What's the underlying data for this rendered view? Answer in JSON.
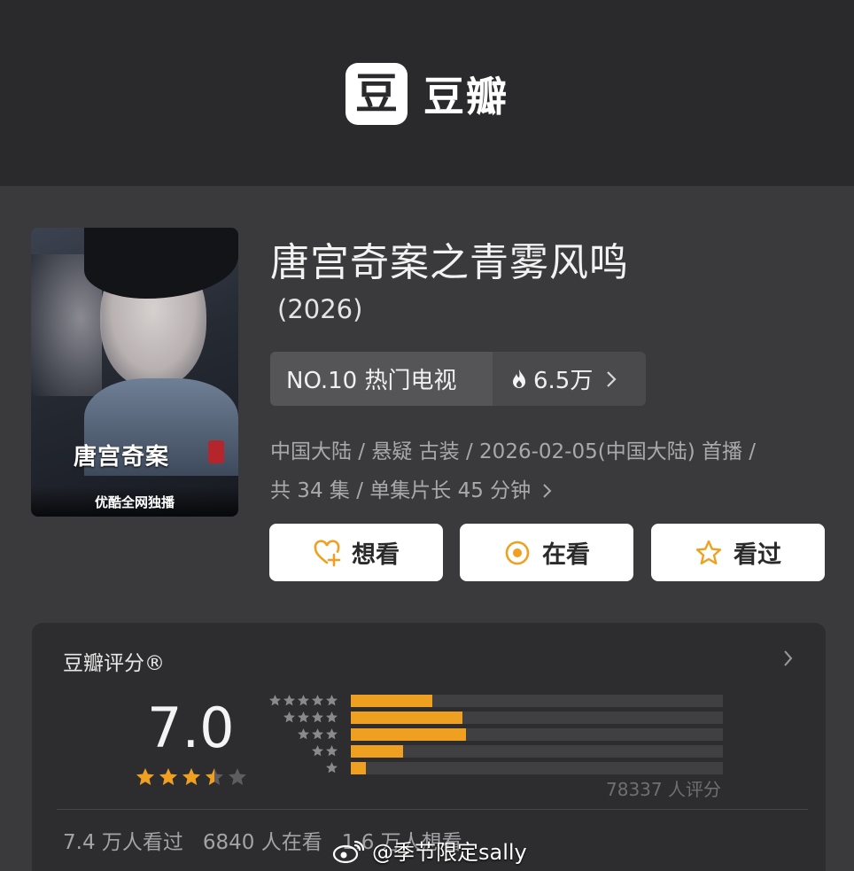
{
  "brand": {
    "logo_glyph": "豆",
    "name": "豆瓣"
  },
  "show": {
    "title": "唐宫奇案之青雾风鸣",
    "year": "(2026)",
    "rank_label": "NO.10 热门电视",
    "heat": "6.5万",
    "meta_line1": "中国大陆 / 悬疑 古装 / 2026-02-05(中国大陆) 首播 /",
    "meta_line2": "共 34 集 / 单集片长 45 分钟",
    "poster": {
      "title_art": "唐宫奇案",
      "channel": "优酷全网独播"
    }
  },
  "actions": {
    "want": "想看",
    "watching": "在看",
    "watched": "看过"
  },
  "rating": {
    "label": "豆瓣评分®",
    "score": "7.0",
    "stars_filled": 3.5,
    "stars_total": 5,
    "distribution": [
      {
        "stars": 5,
        "fraction": 0.22
      },
      {
        "stars": 4,
        "fraction": 0.3
      },
      {
        "stars": 3,
        "fraction": 0.31
      },
      {
        "stars": 2,
        "fraction": 0.14
      },
      {
        "stars": 1,
        "fraction": 0.04
      }
    ],
    "count_text": "78337 人评分",
    "watched_text": "7.4 万人看过",
    "watching_text": "6840 人在看",
    "want_text": "1.6 万人想看"
  },
  "watermark": {
    "text": "@季节限定sally"
  },
  "colors": {
    "accent": "#f0a020",
    "bg": "#3a3a3c",
    "card": "#2d2d2f"
  }
}
